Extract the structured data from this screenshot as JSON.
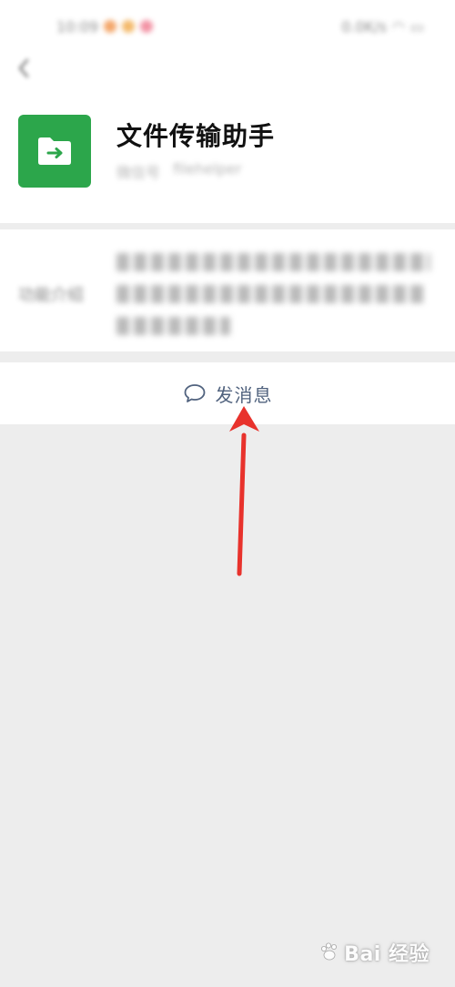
{
  "status_bar": {
    "time": "10:09",
    "network": "0.0K/s"
  },
  "header": {
    "back_icon": "chevron-left-icon",
    "avatar_icon": "folder-arrow-icon",
    "avatar_color": "#2ca64b",
    "contact_name": "文件传输助手",
    "subtitle_label": "微信号",
    "subtitle_value": "filehelper"
  },
  "intro": {
    "label": "功能介绍",
    "text": "登录微信电脑版，和电脑微信互传文件，图片，视频，链接等"
  },
  "send_message": {
    "label": "发消息",
    "icon": "chat-bubble-icon",
    "color": "#50627e"
  },
  "annotation": {
    "color": "#e8322c"
  },
  "watermark": {
    "text": "Bai 经验"
  }
}
